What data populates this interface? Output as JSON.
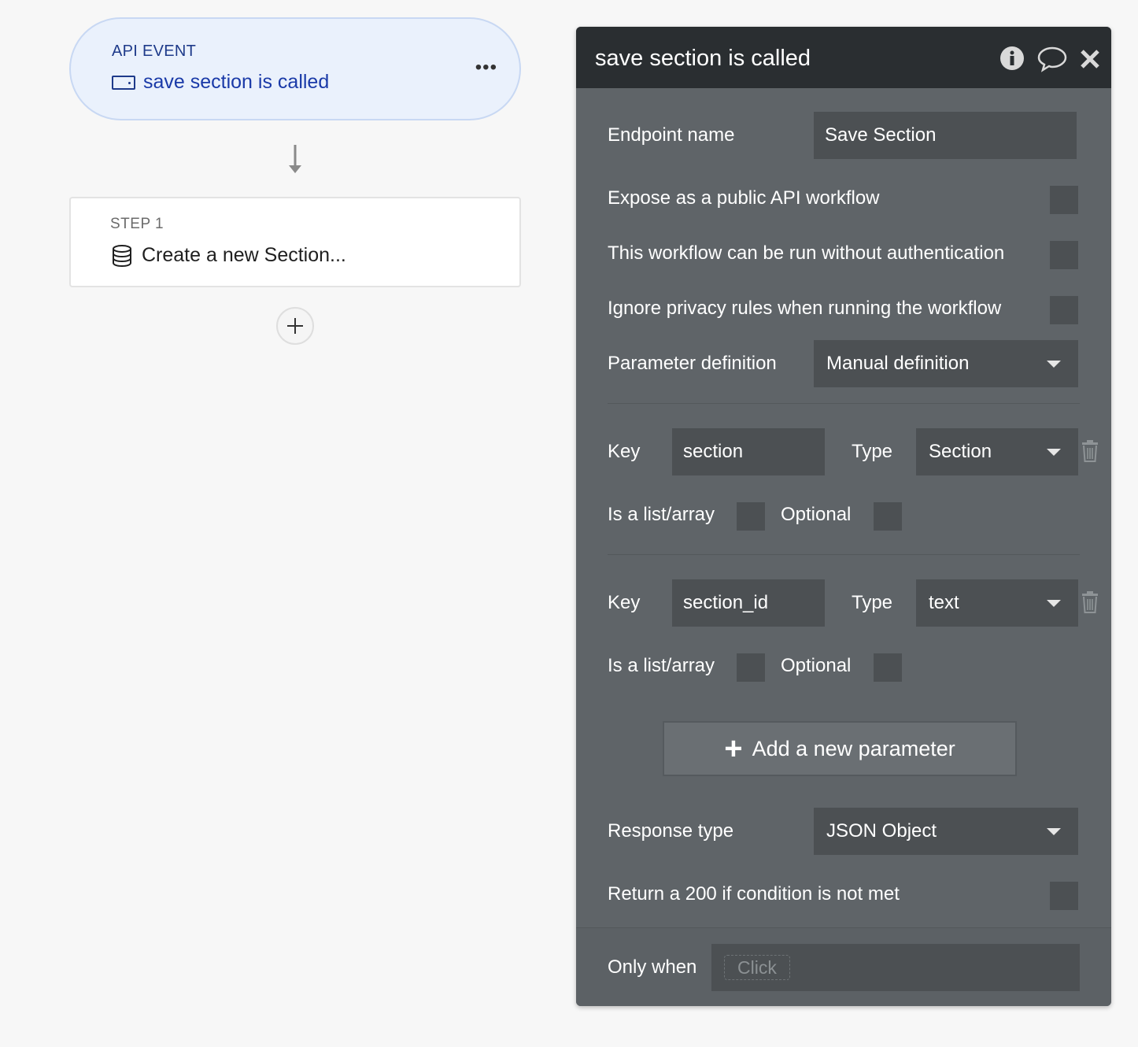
{
  "event": {
    "kicker": "API EVENT",
    "title": "save section is called"
  },
  "step": {
    "kicker": "STEP 1",
    "title": "Create a new Section..."
  },
  "panel": {
    "title": "save section is called",
    "endpoint_label": "Endpoint name",
    "endpoint_value": "Save Section",
    "expose_label": "Expose as a public API workflow",
    "noauth_label": "This workflow can be run without authentication",
    "privacy_label": "Ignore privacy rules when running the workflow",
    "paramdef_label": "Parameter definition",
    "paramdef_value": "Manual definition",
    "params": [
      {
        "key_label": "Key",
        "key": "section",
        "type_label": "Type",
        "type": "Section",
        "list_label": "Is a list/array",
        "optional_label": "Optional"
      },
      {
        "key_label": "Key",
        "key": "section_id",
        "type_label": "Type",
        "type": "text",
        "list_label": "Is a list/array",
        "optional_label": "Optional"
      }
    ],
    "add_param_label": "Add a new parameter",
    "response_label": "Response type",
    "response_value": "JSON Object",
    "return200_label": "Return a 200 if condition is not met",
    "only_when_label": "Only when",
    "only_when_token": "Click"
  },
  "icons": {
    "event": "api-event-icon",
    "step": "database-icon",
    "info": "info-icon",
    "comment": "comment-icon",
    "close": "close-icon",
    "trash": "trash-icon",
    "arrow": "arrow-down-icon",
    "add": "plus-icon"
  }
}
